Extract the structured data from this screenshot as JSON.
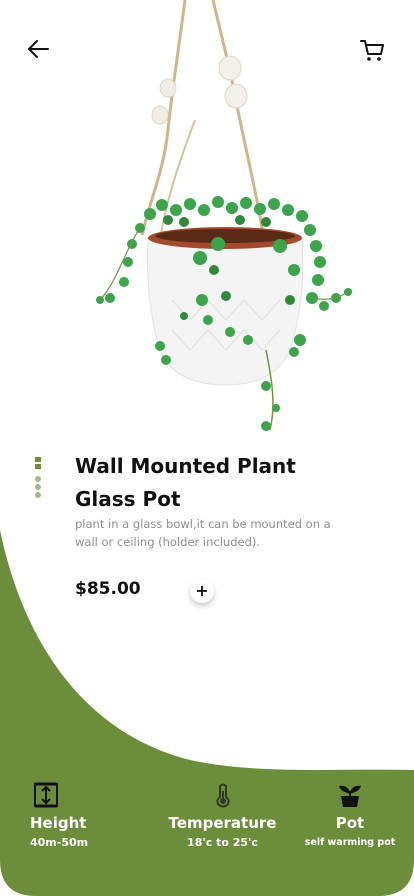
{
  "colors": {
    "accent": "#6c8e3b",
    "text": "#111111",
    "muted": "#8f8f8f",
    "background": "#ffffff"
  },
  "header": {
    "back_icon": "arrow-left-icon",
    "cart_icon": "cart-icon"
  },
  "product": {
    "title_line1": "Wall Mounted Plant",
    "title_line2": "Glass Pot",
    "description": "plant in a glass bowl,it can be mounted on a wall or ceiling (holder included).",
    "price": "$85.00",
    "add_label": "+"
  },
  "gallery": {
    "image_count": 4,
    "active_index": 0
  },
  "features": [
    {
      "icon": "height-icon",
      "label": "Height",
      "value": "40m-50m"
    },
    {
      "icon": "thermometer-icon",
      "label": "Temperature",
      "value": "18'c to 25'c"
    },
    {
      "icon": "plant-pot-icon",
      "label": "Pot",
      "value": "self warming pot"
    }
  ]
}
